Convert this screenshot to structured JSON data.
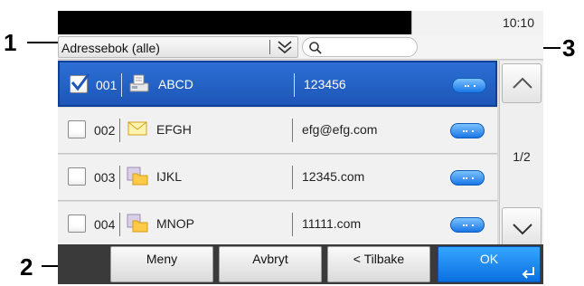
{
  "status": {
    "time": "10:10"
  },
  "toolbar": {
    "addressbook_selected": "Adressebok (alle)",
    "addressbook_chevron_icon": "double-chevron-down-icon",
    "search_icon": "search-icon"
  },
  "list": {
    "rows": [
      {
        "number": "001",
        "name": "ABCD",
        "address": "123456",
        "type_icon": "fax-icon",
        "checked": true
      },
      {
        "number": "002",
        "name": "EFGH",
        "address": "efg@efg.com",
        "type_icon": "email-envelope-icon",
        "checked": false
      },
      {
        "number": "003",
        "name": "IJKL",
        "address": "12345.com",
        "type_icon": "folder-icon",
        "checked": false
      },
      {
        "number": "004",
        "name": "MNOP",
        "address": "11111.com",
        "type_icon": "folder-icon",
        "checked": false
      }
    ],
    "detail_icon": "more-dots-icon"
  },
  "pager": {
    "page_indicator": "1/2",
    "up_icon": "chevron-up-icon",
    "down_icon": "chevron-down-icon"
  },
  "bottom": {
    "menu_label": "Meny",
    "cancel_label": "Avbryt",
    "back_label": "< Tilbake",
    "ok_label": "OK",
    "enter_icon": "enter-return-icon"
  },
  "callouts": {
    "one": "1",
    "two": "2",
    "three": "3"
  },
  "colors": {
    "selected_row": "#1e56b8",
    "ok_button": "#0a6fe0",
    "detail_button": "#1877e6"
  }
}
